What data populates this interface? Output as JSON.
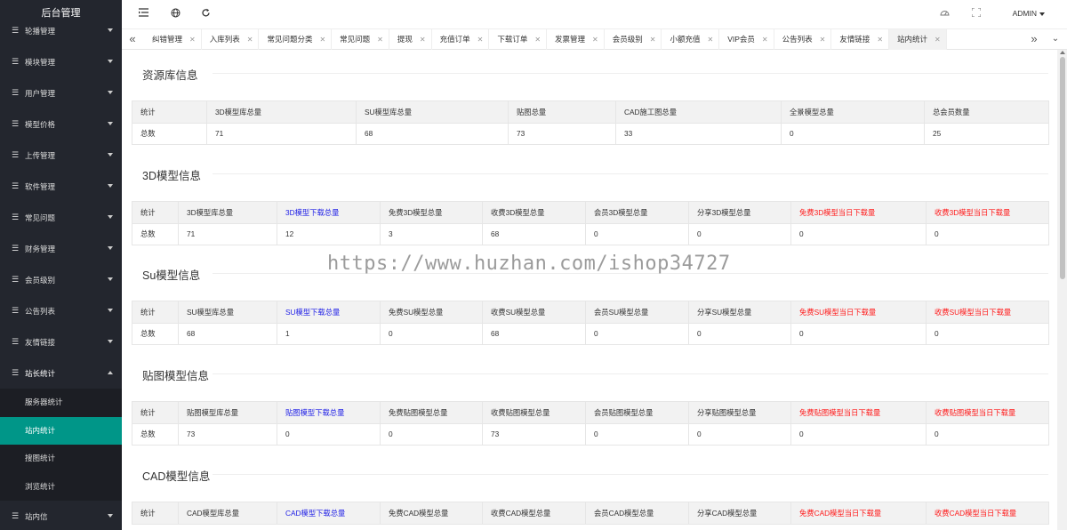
{
  "sidebar": {
    "title": "后台管理",
    "items": [
      {
        "label": "轮播管理"
      },
      {
        "label": "模块管理"
      },
      {
        "label": "用户管理"
      },
      {
        "label": "模型价格"
      },
      {
        "label": "上传管理"
      },
      {
        "label": "软件管理"
      },
      {
        "label": "常见问题"
      },
      {
        "label": "财务管理"
      },
      {
        "label": "会员级别"
      },
      {
        "label": "公告列表"
      },
      {
        "label": "友情链接"
      },
      {
        "label": "站长统计"
      }
    ],
    "sub_items": [
      {
        "label": "服务器统计"
      },
      {
        "label": "站内统计"
      },
      {
        "label": "搜图统计"
      },
      {
        "label": "浏览统计"
      }
    ],
    "last_item": {
      "label": "站内信"
    }
  },
  "topbar": {
    "admin_label": "ADMIN"
  },
  "tabs": [
    {
      "label": "纠错管理"
    },
    {
      "label": "入库列表"
    },
    {
      "label": "常见问题分类"
    },
    {
      "label": "常见问题"
    },
    {
      "label": "提现"
    },
    {
      "label": "充值订单"
    },
    {
      "label": "下载订单"
    },
    {
      "label": "发票管理"
    },
    {
      "label": "会员级别"
    },
    {
      "label": "小额充值"
    },
    {
      "label": "VIP会员"
    },
    {
      "label": "公告列表"
    },
    {
      "label": "友情链接"
    },
    {
      "label": "站内统计"
    }
  ],
  "sections": {
    "resource": {
      "title": "资源库信息",
      "headers": [
        "统计",
        "3D模型库总量",
        "SU模型库总量",
        "贴图总量",
        "CAD施工图总量",
        "全景模型总量",
        "总会员数量"
      ],
      "row": [
        "总数",
        "71",
        "68",
        "73",
        "33",
        "0",
        "25"
      ]
    },
    "d3": {
      "title": "3D模型信息",
      "headers": [
        "统计",
        "3D模型库总量",
        "3D模型下载总量",
        "免费3D模型总量",
        "收费3D模型总量",
        "会员3D模型总量",
        "分享3D模型总量",
        "免费3D模型当日下载量",
        "收费3D模型当日下载量"
      ],
      "row": [
        "总数",
        "71",
        "12",
        "3",
        "68",
        "0",
        "0",
        "0",
        "0"
      ]
    },
    "su": {
      "title": "Su模型信息",
      "headers": [
        "统计",
        "SU模型库总量",
        "SU模型下载总量",
        "免费SU模型总量",
        "收费SU模型总量",
        "会员SU模型总量",
        "分享SU模型总量",
        "免费SU模型当日下载量",
        "收费SU模型当日下载量"
      ],
      "row": [
        "总数",
        "68",
        "1",
        "0",
        "68",
        "0",
        "0",
        "0",
        "0"
      ]
    },
    "tex": {
      "title": "贴图模型信息",
      "headers": [
        "统计",
        "贴图模型库总量",
        "贴图模型下载总量",
        "免费贴图模型总量",
        "收费贴图模型总量",
        "会员贴图模型总量",
        "分享贴图模型总量",
        "免费贴图模型当日下载量",
        "收费贴图模型当日下载量"
      ],
      "row": [
        "总数",
        "73",
        "0",
        "0",
        "73",
        "0",
        "0",
        "0",
        "0"
      ]
    },
    "cad": {
      "title": "CAD模型信息",
      "headers": [
        "统计",
        "CAD模型库总量",
        "CAD模型下载总量",
        "免费CAD模型总量",
        "收费CAD模型总量",
        "会员CAD模型总量",
        "分享CAD模型总量",
        "免费CAD模型当日下载量",
        "收费CAD模型当日下载量"
      ]
    }
  },
  "watermark": "https://www.huzhan.com/ishop34727",
  "colors": {
    "sidebar_bg": "#23262e",
    "active_green": "#009688",
    "highlight_blue": "#1e1ee6",
    "highlight_red": "#ff1a1a"
  }
}
